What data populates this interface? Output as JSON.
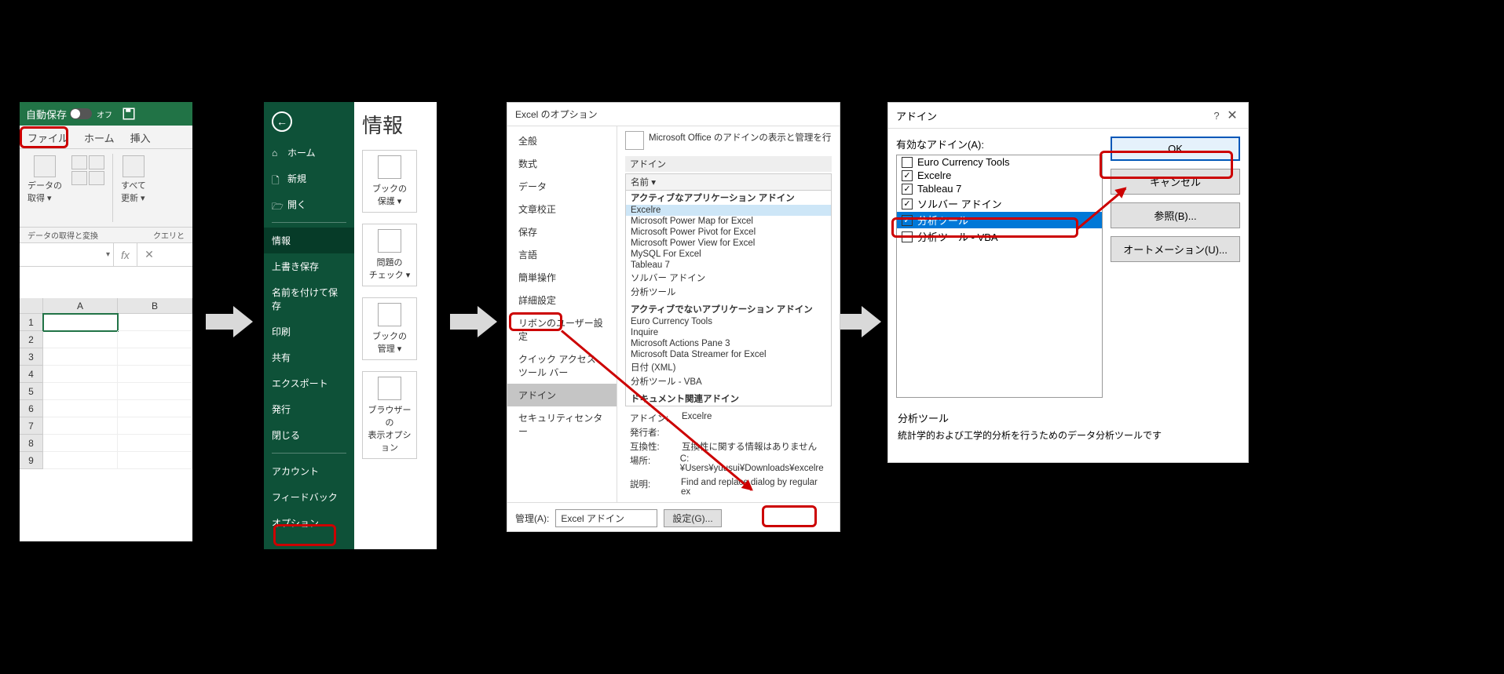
{
  "panel1": {
    "autosave_label": "自動保存",
    "autosave_state": "オフ",
    "tabs": {
      "file": "ファイル",
      "home": "ホーム",
      "insert": "挿入"
    },
    "ribbon": {
      "getdata_line1": "データの",
      "getdata_line2": "取得",
      "refresh_line1": "すべて",
      "refresh_line2": "更新"
    },
    "group1": "データの取得と変換",
    "group2": "クエリと",
    "cols": {
      "A": "A",
      "B": "B"
    },
    "rows": [
      "1",
      "2",
      "3",
      "4",
      "5",
      "6",
      "7",
      "8",
      "9"
    ]
  },
  "panel2": {
    "title": "情報",
    "nav": {
      "home": "ホーム",
      "new": "新規",
      "open": "開く",
      "info": "情報",
      "save": "上書き保存",
      "saveas_l1": "名前を付けて保",
      "saveas_l2": "存",
      "print": "印刷",
      "share": "共有",
      "export": "エクスポート",
      "publish": "発行",
      "close": "閉じる",
      "account": "アカウント",
      "feedback": "フィードバック",
      "options": "オプション"
    },
    "cards": {
      "protect_l1": "ブックの",
      "protect_l2": "保護",
      "check_l1": "問題の",
      "check_l2": "チェック",
      "manage_l1": "ブックの",
      "manage_l2": "管理",
      "browser_l1": "ブラウザーの",
      "browser_l2": "表示オプション"
    }
  },
  "panel3": {
    "title": "Excel のオプション",
    "side": {
      "general": "全般",
      "formulas": "数式",
      "data": "データ",
      "proofing": "文章校正",
      "save": "保存",
      "language": "言語",
      "ease": "簡単操作",
      "advanced": "詳細設定",
      "customize_ribbon": "リボンのユーザー設定",
      "qat": "クイック アクセス ツール バー",
      "addins": "アドイン",
      "trust": "セキュリティセンター"
    },
    "header": "Microsoft Office のアドインの表示と管理を行",
    "sect_addins": "アドイン",
    "col_name": "名前 ▾",
    "group_active": "アクティブなアプリケーション アドイン",
    "active": [
      "Excelre",
      "Microsoft Power Map for Excel",
      "Microsoft Power Pivot for Excel",
      "Microsoft Power View for Excel",
      "MySQL For Excel",
      "Tableau 7",
      "ソルバー アドイン",
      "分析ツール"
    ],
    "group_inactive": "アクティブでないアプリケーション アドイン",
    "inactive": [
      "Euro Currency Tools",
      "Inquire",
      "Microsoft Actions Pane 3",
      "Microsoft Data Streamer for Excel",
      "日付 (XML)",
      "分析ツール - VBA"
    ],
    "group_doc": "ドキュメント関連アドイン",
    "meta": {
      "addin_k": "アドイン:",
      "addin_v": "Excelre",
      "pub_k": "発行者:",
      "compat_k": "互換性:",
      "compat_v": "互換性に関する情報はありません",
      "loc_k": "場所:",
      "loc_v": "C:¥Users¥yuusui¥Downloads¥excelre",
      "desc_k": "説明:",
      "desc_v": "Find and replace dialog by regular ex"
    },
    "manage_label": "管理(A):",
    "manage_value": "Excel アドイン",
    "settings_btn": "設定(G)..."
  },
  "panel4": {
    "title": "アドイン",
    "label": "有効なアドイン(A):",
    "items": [
      {
        "label": "Euro Currency Tools",
        "checked": false
      },
      {
        "label": "Excelre",
        "checked": true
      },
      {
        "label": "Tableau 7",
        "checked": true
      },
      {
        "label": "ソルバー アドイン",
        "checked": true
      },
      {
        "label": "分析ツール",
        "checked": true,
        "selected": true
      },
      {
        "label": "分析ツール - VBA",
        "checked": false
      }
    ],
    "ok": "OK",
    "cancel": "キャンセル",
    "browse": "参照(B)...",
    "automation": "オートメーション(U)...",
    "desc_title": "分析ツール",
    "desc_body": "統計学的および工学的分析を行うためのデータ分析ツールです"
  }
}
